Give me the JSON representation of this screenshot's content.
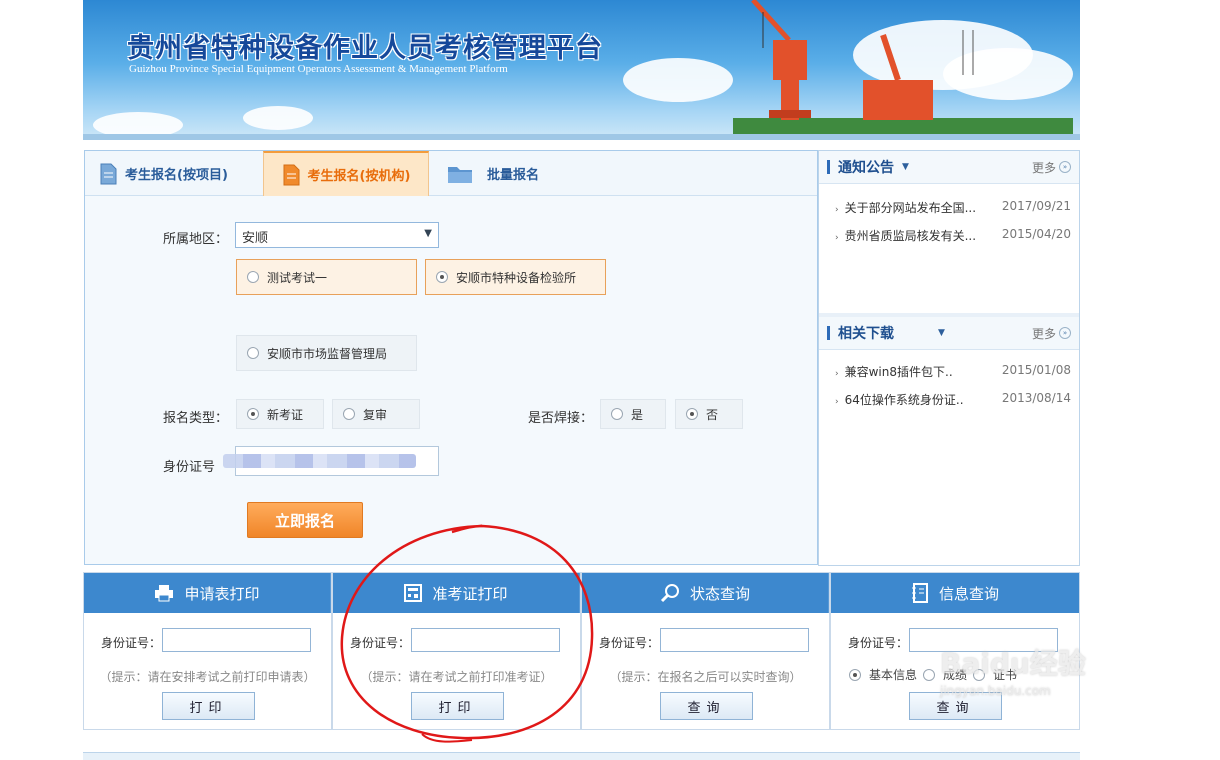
{
  "header": {
    "title": "贵州省特种设备作业人员考核管理平台",
    "subtitle": "Guizhou Province Special Equipment Operators Assessment & Management Platform"
  },
  "tabs": [
    {
      "label": "考生报名(按项目)",
      "icon": "document-icon",
      "active": false
    },
    {
      "label": "考生报名(按机构)",
      "icon": "document-icon",
      "active": true
    },
    {
      "label": "批量报名",
      "icon": "folder-icon",
      "active": false
    }
  ],
  "form": {
    "region_label": "所属地区：",
    "region_value": "安顺",
    "institutions": [
      {
        "label": "测试考试一",
        "selected": false
      },
      {
        "label": "安顺市特种设备检验所",
        "selected": true
      },
      {
        "label": "安顺市市场监督管理局",
        "selected": false
      }
    ],
    "type_label": "报名类型：",
    "type_options": [
      {
        "label": "新考证",
        "selected": true
      },
      {
        "label": "复审",
        "selected": false
      }
    ],
    "weld_label": "是否焊接：",
    "weld_options": [
      {
        "label": "是",
        "selected": false
      },
      {
        "label": "否",
        "selected": true
      }
    ],
    "id_label": "身份证号",
    "submit_label": "立即报名"
  },
  "notices": {
    "title": "通知公告",
    "more": "更多",
    "items": [
      {
        "text": "关于部分网站发布全国...",
        "date": "2017/09/21"
      },
      {
        "text": "贵州省质监局核发有关...",
        "date": "2015/04/20"
      }
    ]
  },
  "downloads": {
    "title": "相关下载",
    "more": "更多",
    "items": [
      {
        "text": "兼容win8插件包下..",
        "date": "2015/01/08"
      },
      {
        "text": "64位操作系统身份证..",
        "date": "2013/08/14"
      }
    ]
  },
  "cards": [
    {
      "title": "申请表打印",
      "icon": "printer-icon",
      "field_label": "身份证号：",
      "hint": "（提示：请在安排考试之前打印申请表）",
      "button": "打印"
    },
    {
      "title": "准考证打印",
      "icon": "calculator-icon",
      "field_label": "身份证号：",
      "hint": "（提示：请在考试之前打印准考证）",
      "button": "打印"
    },
    {
      "title": "状态查询",
      "icon": "search-icon",
      "field_label": "身份证号：",
      "hint": "（提示：在报名之后可以实时查询）",
      "button": "查询"
    },
    {
      "title": "信息查询",
      "icon": "notebook-icon",
      "field_label": "身份证号：",
      "radio_options": [
        "基本信息",
        "成绩",
        "证书"
      ],
      "button": "查询"
    }
  ],
  "watermark": {
    "brand": "Baidu经验",
    "url": "jingyan.baidu.com"
  },
  "colors": {
    "accent_blue": "#3d88ce",
    "accent_orange": "#f08528",
    "annotation_red": "#e01818"
  }
}
